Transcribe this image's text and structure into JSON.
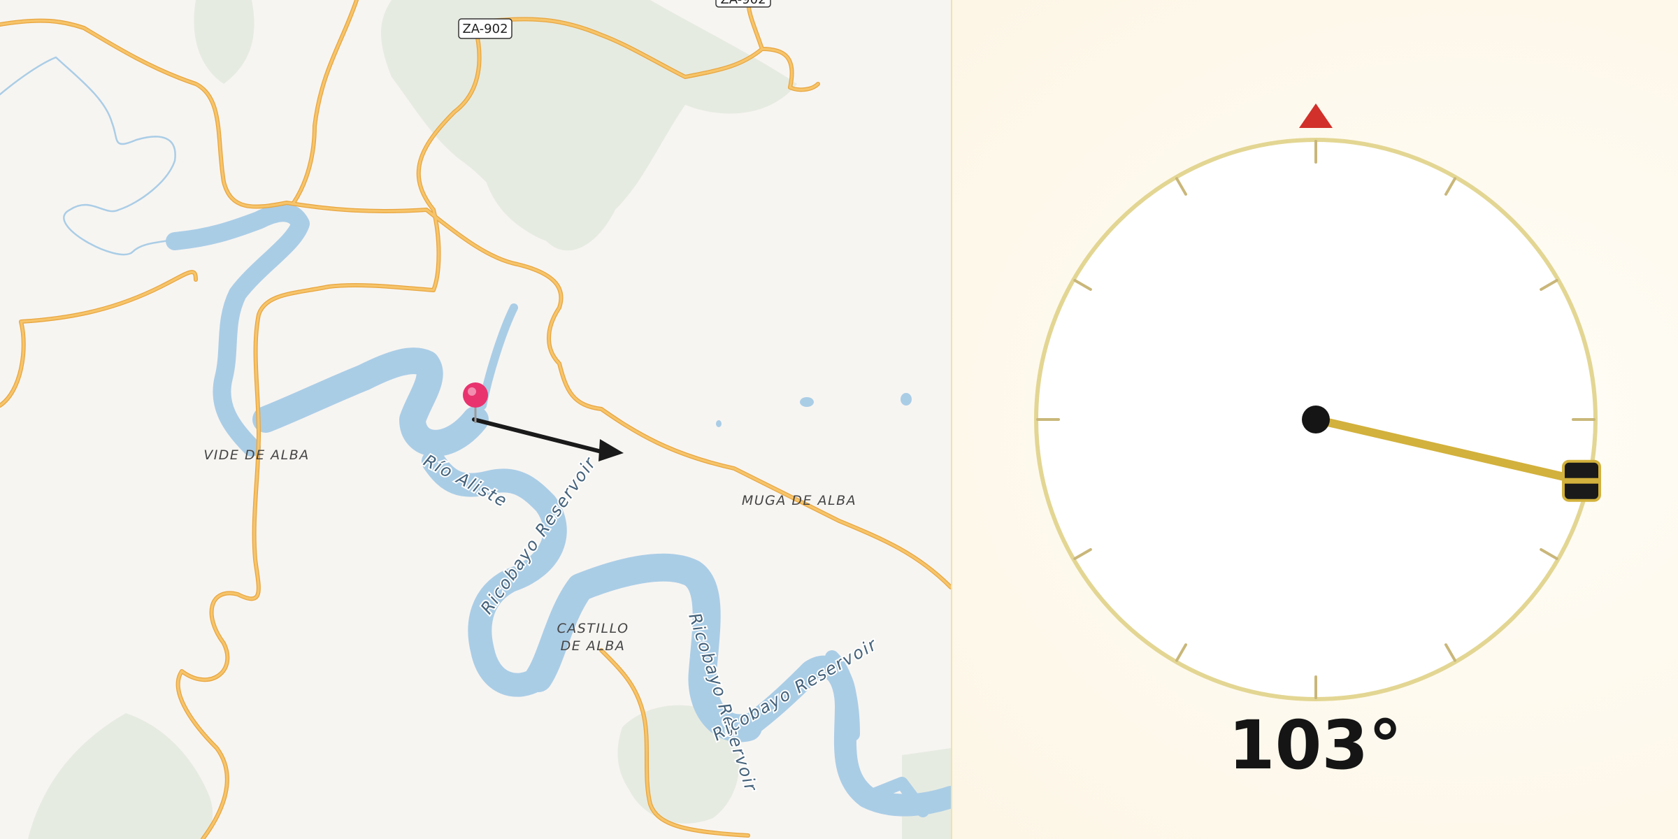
{
  "map": {
    "road_shields": [
      "ZA-902",
      "ZA-902"
    ],
    "places": {
      "vide_de_alba": "VIDE DE ALBA",
      "muga_de_alba": "MUGA DE ALBA",
      "castillo_line1": "CASTILLO",
      "castillo_line2": "DE ALBA"
    },
    "water_labels": {
      "rio_aliste": "Río Aliste",
      "reservoir_1": "Ricobayo Reservoir",
      "reservoir_2": "Ricobayo Reservoir",
      "reservoir_3": "Ricobayo Reservoir"
    },
    "colors": {
      "background": "#f7f5f2",
      "water": "#aacde6",
      "road": "#f6c46a",
      "road_casing": "#e8a53e",
      "vegetation": "#e7ece2",
      "pin": "#e8336f",
      "arrow": "#1a1a1a"
    },
    "icons": {
      "pin": "map-pin-icon",
      "arrow": "direction-arrow-icon"
    }
  },
  "compass": {
    "heading_degrees": 103,
    "heading_text": "103°",
    "colors": {
      "ring": "#e3d693",
      "tick": "#c9b77a",
      "north_marker": "#d2302a",
      "needle": "#d2b13c",
      "hub": "#151515"
    },
    "icons": {
      "north": "north-marker-icon",
      "handle": "needle-handle-icon"
    }
  }
}
